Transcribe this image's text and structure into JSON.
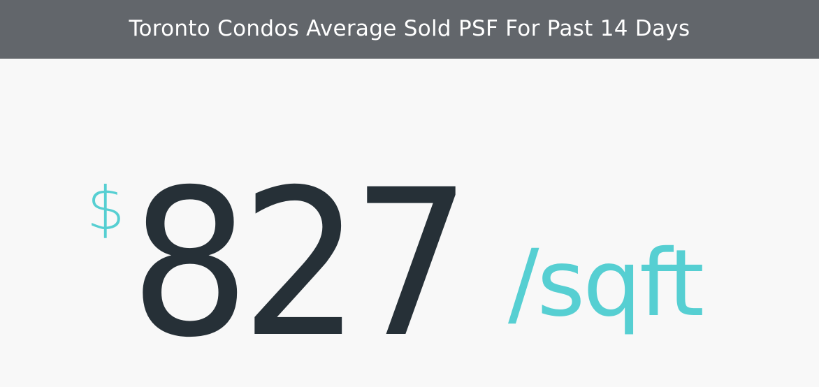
{
  "header": {
    "title": "Toronto Condos Average Sold PSF For Past 14 Days"
  },
  "stat": {
    "currency": "$",
    "value": "827",
    "unit": "/sqft"
  },
  "colors": {
    "header_background": "#62666b",
    "header_text": "#ffffff",
    "value_text": "#263037",
    "accent": "#56cfd2",
    "page_background": "#f8f8f8"
  }
}
